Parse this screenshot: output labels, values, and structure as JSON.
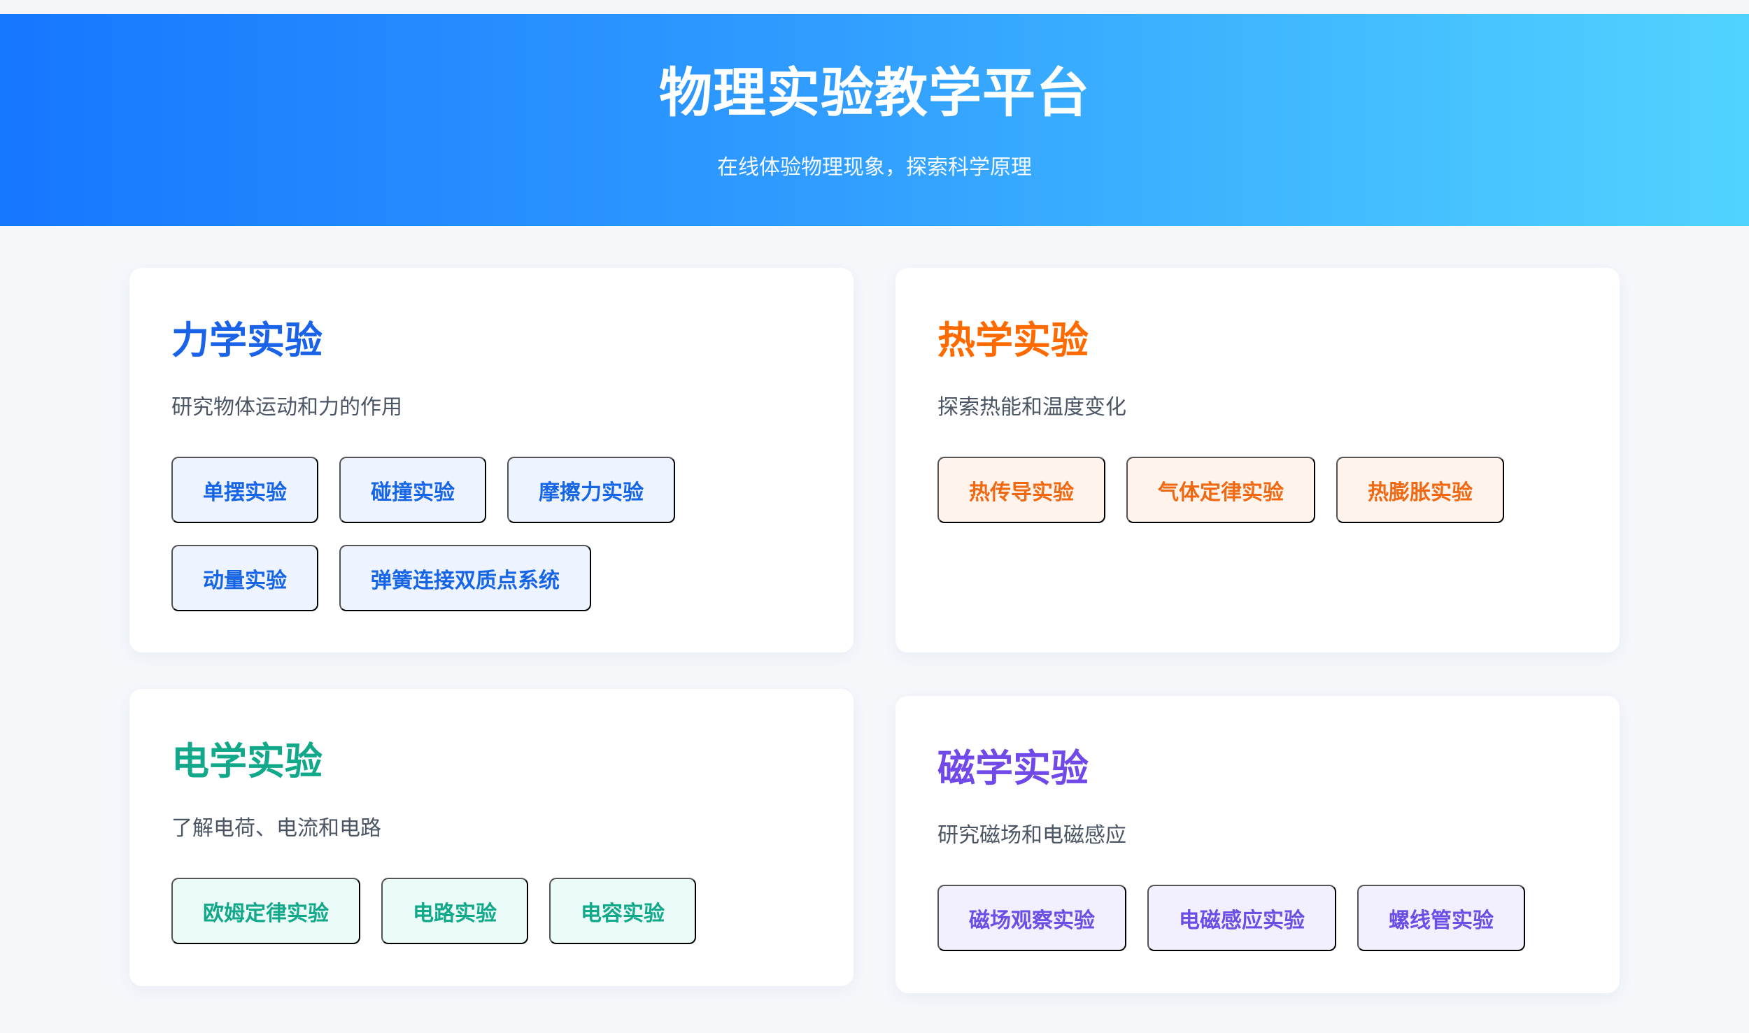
{
  "header": {
    "title": "物理实验教学平台",
    "subtitle": "在线体验物理现象，探索科学原理"
  },
  "sections": [
    {
      "title": "力学实验",
      "description": "研究物体运动和力的作用",
      "accent": "#1a63e8",
      "experiments": [
        "单摆实验",
        "碰撞实验",
        "摩擦力实验",
        "动量实验",
        "弹簧连接双质点系统"
      ]
    },
    {
      "title": "热学实验",
      "description": "探索热能和温度变化",
      "accent": "#ff6a00",
      "experiments": [
        "热传导实验",
        "气体定律实验",
        "热膨胀实验"
      ]
    },
    {
      "title": "电学实验",
      "description": "了解电荷、电流和电路",
      "accent": "#12a88a",
      "experiments": [
        "欧姆定律实验",
        "电路实验",
        "电容实验"
      ]
    },
    {
      "title": "磁学实验",
      "description": "研究磁场和电磁感应",
      "accent": "#7049e8",
      "experiments": [
        "磁场观察实验",
        "电磁感应实验",
        "螺线管实验"
      ]
    }
  ]
}
